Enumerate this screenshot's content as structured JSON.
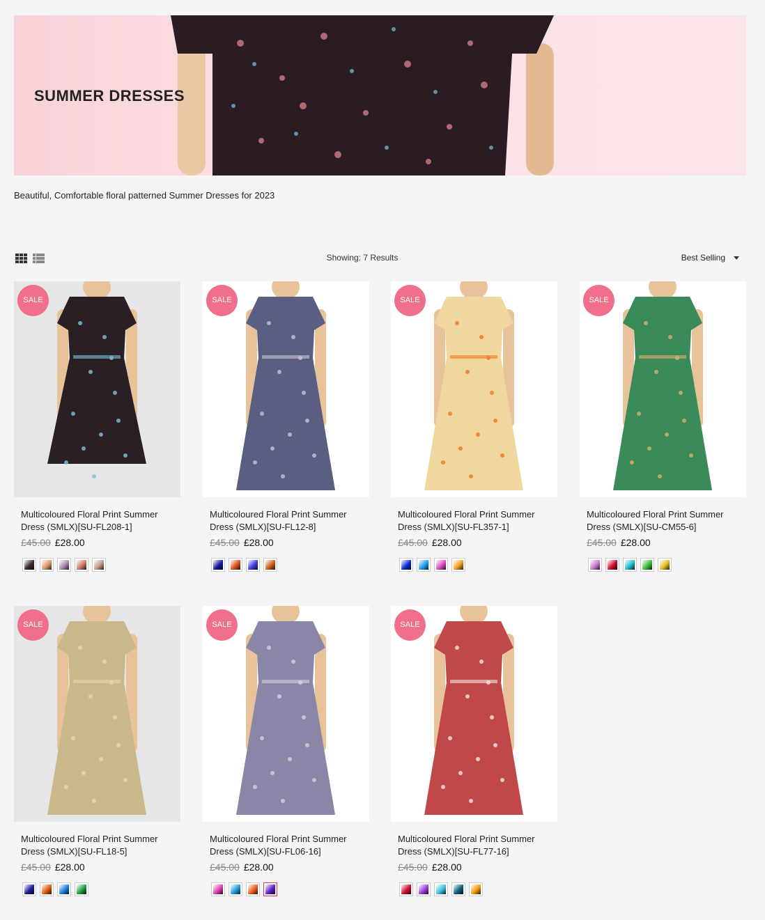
{
  "banner": {
    "title": "SUMMER DRESSES"
  },
  "description": "Beautiful, Comfortable floral patterned Summer Dresses for 2023",
  "toolbar": {
    "grid_icon": "grid-view-icon",
    "list_icon": "list-view-icon",
    "showing": "Showing: 7 Results",
    "sort_label": "Best Selling"
  },
  "colors": {
    "sale_badge": "#f06f8a",
    "background": "#f5f5f5",
    "banner": "#fbe0e4"
  },
  "products": [
    {
      "name": "Multicoloured Floral Print Summer Dress (SMLX)[SU-FL208-1]",
      "badge": "SALE",
      "old_price": "£45.00",
      "price": "£28.00",
      "dress_color": "#2a1f24",
      "accent": "#7cc3d8",
      "swatches": [
        "#3a2a2a",
        "#e09a6a",
        "#a98ab8",
        "#d07a6a",
        "#c99a8a"
      ]
    },
    {
      "name": "Multicoloured Floral Print Summer Dress (SMLX)[SU-FL12-8]",
      "badge": "SALE",
      "old_price": "£45.00",
      "price": "£28.00",
      "dress_color": "#5a5f82",
      "accent": "#c8c4d8",
      "swatches": [
        "#1a1aa0",
        "#e05020",
        "#4040e0",
        "#d06020"
      ]
    },
    {
      "name": "Multicoloured Floral Print Summer Dress (SMLX)[SU-FL357-1]",
      "badge": "SALE",
      "old_price": "£45.00",
      "price": "£28.00",
      "dress_color": "#f0d7a0",
      "accent": "#ef7a20",
      "swatches": [
        "#1030d0",
        "#20a0f0",
        "#e050c0",
        "#f0a020"
      ]
    },
    {
      "name": "Multicoloured Floral Print Summer Dress (SMLX)[SU-CM55-6]",
      "badge": "SALE",
      "old_price": "£45.00",
      "price": "£28.00",
      "dress_color": "#3a8a5a",
      "accent": "#d9b070",
      "swatches": [
        "#d07ad0",
        "#d01030",
        "#20c0d0",
        "#40c040",
        "#e0c020"
      ]
    },
    {
      "name": "Multicoloured Floral Print Summer Dress (SMLX)[SU-FL18-5]",
      "badge": "SALE",
      "old_price": "£45.00",
      "price": "£28.00",
      "dress_color": "#c9b98a",
      "accent": "#e8d9a8",
      "swatches": [
        "#2020a0",
        "#e06010",
        "#2080e0",
        "#20a040"
      ]
    },
    {
      "name": "Multicoloured Floral Print Summer Dress (SMLX)[SU-FL06-16]",
      "badge": "SALE",
      "old_price": "£45.00",
      "price": "£28.00",
      "dress_color": "#8a86a8",
      "accent": "#d8d0e0",
      "swatches": [
        "#e040b0",
        "#20a0e0",
        "#f06020",
        "#6020d0"
      ]
    },
    {
      "name": "Multicoloured Floral Print Summer Dress (SMLX)[SU-FL77-16]",
      "badge": "SALE",
      "old_price": "£45.00",
      "price": "£28.00",
      "dress_color": "#c04848",
      "accent": "#f0e6e0",
      "swatches": [
        "#d01030",
        "#a040e0",
        "#40c0e0",
        "#106080",
        "#f0a010"
      ]
    }
  ]
}
